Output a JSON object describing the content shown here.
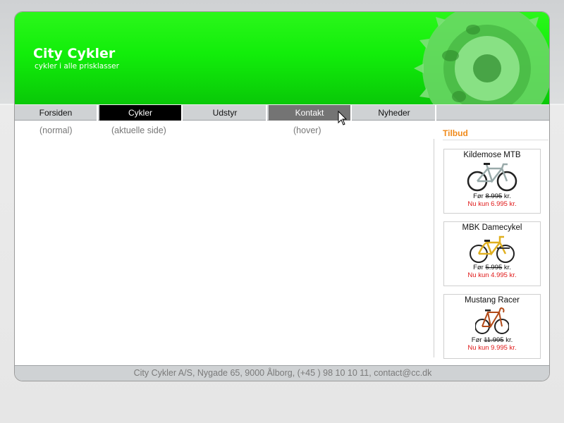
{
  "header": {
    "site_title": "City Cykler",
    "tagline": "cykler i alle prisklasser"
  },
  "nav": {
    "items": [
      {
        "label": "Forsiden",
        "state": "normal"
      },
      {
        "label": "Cykler",
        "state": "current"
      },
      {
        "label": "Udstyr",
        "state": "normal"
      },
      {
        "label": "Kontakt",
        "state": "hover"
      },
      {
        "label": "Nyheder",
        "state": "normal"
      }
    ],
    "notes": {
      "normal": "(normal)",
      "current": "(aktuelle side)",
      "hover": "(hover)"
    }
  },
  "sidebar": {
    "title": "Tilbud",
    "before_prefix": "Før",
    "offers": [
      {
        "name": "Kildemose MTB",
        "old_price": "8.995",
        "old_suffix": "kr.",
        "new_price": "Nu kun 6.995 kr."
      },
      {
        "name": "MBK Damecykel",
        "old_price": "5.995",
        "old_suffix": "kr.",
        "new_price": "Nu kun 4.995 kr."
      },
      {
        "name": "Mustang Racer",
        "old_price": "11.995",
        "old_suffix": "kr.",
        "new_price": "Nu kun 9.995 kr."
      }
    ]
  },
  "footer": {
    "text": "City Cykler A/S, Nygade 65, 9000 Ålborg, (+45 ) 98 10 10 11, contact@cc.dk"
  },
  "colors": {
    "header_green": "#12ee0a",
    "nav_current_bg": "#000000",
    "nav_hover_bg": "#747474",
    "tilbud_orange": "#f08a1a",
    "sale_red": "#e01818"
  },
  "icons": [
    "chainring-gear-icon",
    "mouse-cursor-icon",
    "mountain-bike-icon",
    "city-bike-icon",
    "racer-bike-icon"
  ]
}
